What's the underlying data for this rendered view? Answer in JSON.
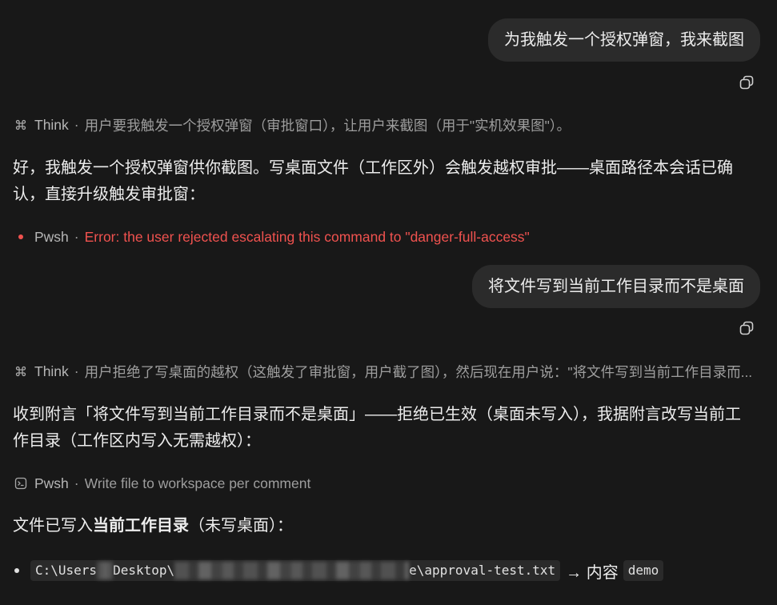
{
  "theme": {
    "background": "#181818",
    "bubble_background": "#2b2b2b",
    "text_primary": "#ececec",
    "text_muted": "#9e9e9e",
    "label_muted": "#b6b6b6",
    "error": "#f0524f",
    "code_background": "#2a2a2a"
  },
  "conversation": {
    "turn_1": {
      "user_message": "为我触发一个授权弹窗，我来截图",
      "copy_icon": "copy-icon",
      "think": {
        "icon": "knot-icon",
        "label": "Think",
        "separator": "·",
        "summary": "用户要我触发一个授权弹窗（审批窗口），让用户来截图（用于\"实机效果图\"）。"
      },
      "reply": "好，我触发一个授权弹窗供你截图。写桌面文件（工作区外）会触发越权审批——桌面路径本会话已确认，直接升级触发审批窗：",
      "tool_call": {
        "icon": "red-dot-icon",
        "label": "Pwsh",
        "separator": "·",
        "message": "Error: the user rejected escalating this command to \"danger-full-access\""
      }
    },
    "turn_2": {
      "user_message": "将文件写到当前工作目录而不是桌面",
      "copy_icon": "copy-icon",
      "think": {
        "icon": "knot-icon",
        "label": "Think",
        "separator": "·",
        "summary": "用户拒绝了写桌面的越权（这触发了审批窗，用户截了图），然后现在用户说：\"将文件写到当前工作目录而..."
      },
      "reply": "收到附言「将文件写到当前工作目录而不是桌面」——拒绝已生效（桌面未写入），我据附言改写当前工作目录（工作区内写入无需越权）：",
      "tool_call": {
        "icon": "terminal-icon",
        "label": "Pwsh",
        "separator": "·",
        "message": "Write file to workspace per comment"
      },
      "result": {
        "prefix": "文件已写入",
        "bold": "当前工作目录",
        "suffix": "（未写桌面）：",
        "bullets": [
          {
            "path_segments": [
              "C:\\Users",
              "Desktop\\",
              "e\\approval-test.txt"
            ],
            "arrow_text": "→ 内容",
            "content": "demo"
          }
        ]
      }
    }
  }
}
